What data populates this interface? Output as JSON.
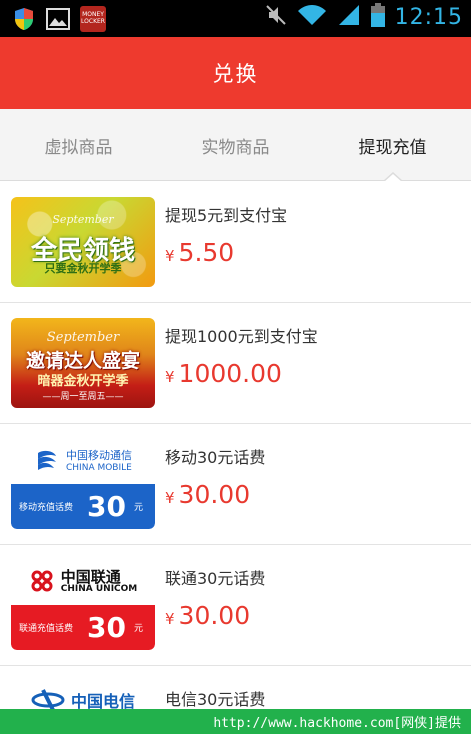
{
  "status_bar": {
    "time": "12:15",
    "icons": [
      "shield-icon",
      "image-icon",
      "money-locker-icon",
      "mute-icon",
      "wifi-icon",
      "signal-icon",
      "battery-icon"
    ],
    "app_icon_text": "MONEY LOCKER"
  },
  "app_bar": {
    "title": "兑换",
    "color": "#ee3a2e"
  },
  "tabs": [
    {
      "label": "虚拟商品",
      "active": false
    },
    {
      "label": "实物商品",
      "active": false
    },
    {
      "label": "提现充值",
      "active": true
    }
  ],
  "items": [
    {
      "title": "提现5元到支付宝",
      "currency": "¥",
      "price": "5.50",
      "thumb": {
        "kind": "banner",
        "sept": "September",
        "big": "全民领钱",
        "sub": "只要金秋开学季"
      }
    },
    {
      "title": "提现1000元到支付宝",
      "currency": "¥",
      "price": "1000.00",
      "thumb": {
        "kind": "banner",
        "sept": "September",
        "big": "邀请达人盛宴",
        "sub": "暗器金秋开学季",
        "sub2": "——周一至周五——"
      }
    },
    {
      "title": "移动30元话费",
      "currency": "¥",
      "price": "30.00",
      "thumb": {
        "kind": "carrier",
        "brand_cn": "中国移动通信",
        "brand_en": "CHINA MOBILE",
        "bar_label": "移动充值话费",
        "amount": "30",
        "unit": "元",
        "color": "#1c64c8"
      }
    },
    {
      "title": "联通30元话费",
      "currency": "¥",
      "price": "30.00",
      "thumb": {
        "kind": "carrier",
        "brand_cn": "中国联通",
        "brand_en": "CHINA UNICOM",
        "bar_label": "联通充值话费",
        "amount": "30",
        "unit": "元",
        "color": "#e61b23"
      }
    },
    {
      "title": "电信30元话费",
      "thumb": {
        "kind": "carrier",
        "brand_cn": "中国电信"
      }
    }
  ],
  "watermark": {
    "text": "http://www.hackhome.com[网侠]提供"
  },
  "colors": {
    "accent": "#ee3a2e",
    "price": "#e8392f",
    "status_time": "#33b5e5",
    "watermark_bg": "#22b14c"
  }
}
